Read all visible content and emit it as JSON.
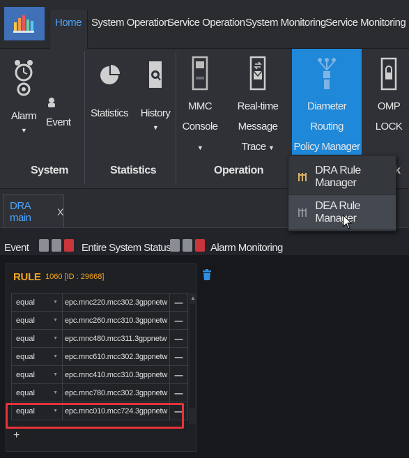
{
  "tabs": {
    "home": "Home",
    "system_operation": "System Operation",
    "service_operation": "Service Operation",
    "system_monitoring": "System Monitoring",
    "service_monitoring": "Service Monitoring"
  },
  "ribbon": {
    "alarm_label": "Alarm",
    "event_label": "Event",
    "statistics_label": "Statistics",
    "history_label": "History",
    "mmc_line1": "MMC",
    "mmc_line2": "Console",
    "rt_line1": "Real-time",
    "rt_line2": "Message Trace",
    "dra_line1": "Diameter Routing",
    "dra_line2": "Policy Manager",
    "omp_label": "OMP LOCK",
    "caret": "▼",
    "groups": {
      "system": "System",
      "statistics": "Statistics",
      "operation": "Operation",
      "partial": "k"
    }
  },
  "dropdown": {
    "items": [
      {
        "label": "DRA Rule Manager"
      },
      {
        "label": "DEA Rule Manager"
      }
    ]
  },
  "doc_tab": {
    "label": "DRA main",
    "close": "X"
  },
  "panels": {
    "event": "Event",
    "entire_status": "Entire System Status",
    "alarm_monitoring": "Alarm Monitoring"
  },
  "rule_panel": {
    "title": "RULE",
    "id": "1060 [ID : 29668]",
    "add": "+",
    "rows": [
      {
        "op": "equal",
        "value": "epc.mnc220.mcc302.3gppnetw",
        "del": "—"
      },
      {
        "op": "equal",
        "value": "epc.mnc260.mcc310.3gppnetw",
        "del": "—"
      },
      {
        "op": "equal",
        "value": "epc.mnc480.mcc311.3gppnetw",
        "del": "—"
      },
      {
        "op": "equal",
        "value": "epc.mnc610.mcc302.3gppnetw",
        "del": "—"
      },
      {
        "op": "equal",
        "value": "epc.mnc410.mcc310.3gppnetw",
        "del": "—"
      },
      {
        "op": "equal",
        "value": "epc.mnc780.mcc302.3gppnetw",
        "del": "—"
      },
      {
        "op": "equal",
        "value": "epc.mnc010.mcc724.3gppnetw",
        "del": "—"
      }
    ]
  },
  "colors": {
    "accent_blue": "#1f88d8",
    "tab_text_active": "#4ea3ff",
    "rule_orange": "#f5a623",
    "highlight_red": "#e5343a"
  },
  "icons": [
    "app-logo-icon",
    "alarm-clock-icon",
    "event-icon",
    "statistics-pie-icon",
    "history-icon",
    "mmc-console-icon",
    "message-trace-icon",
    "routing-policy-icon",
    "omp-lock-icon",
    "rule-manager-icon",
    "trash-icon"
  ]
}
